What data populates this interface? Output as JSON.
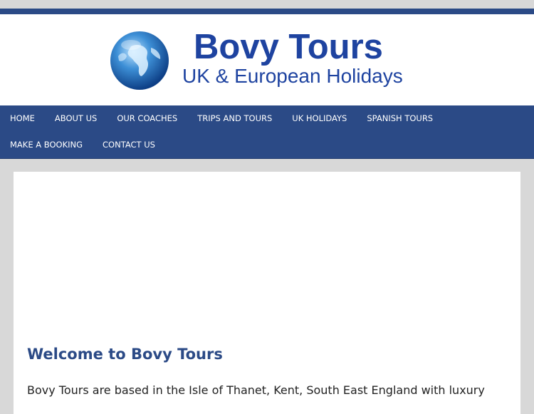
{
  "header": {
    "brand": "Bovy Tours",
    "tagline": "UK & European Holidays",
    "logo_icon": "globe-icon"
  },
  "nav": {
    "items": [
      {
        "label": "HOME"
      },
      {
        "label": "ABOUT US"
      },
      {
        "label": "OUR COACHES"
      },
      {
        "label": "TRIPS AND TOURS"
      },
      {
        "label": "UK HOLIDAYS"
      },
      {
        "label": "SPANISH TOURS"
      },
      {
        "label": "MAKE A BOOKING"
      },
      {
        "label": "CONTACT US"
      }
    ]
  },
  "main": {
    "heading": "Welcome to Bovy Tours",
    "intro": "Bovy Tours are based in the Isle of Thanet, Kent, South East England with luxury"
  },
  "colors": {
    "nav_background": "#2b4a86",
    "brand_text": "#1e43a0",
    "page_background": "#d8d8d8"
  }
}
